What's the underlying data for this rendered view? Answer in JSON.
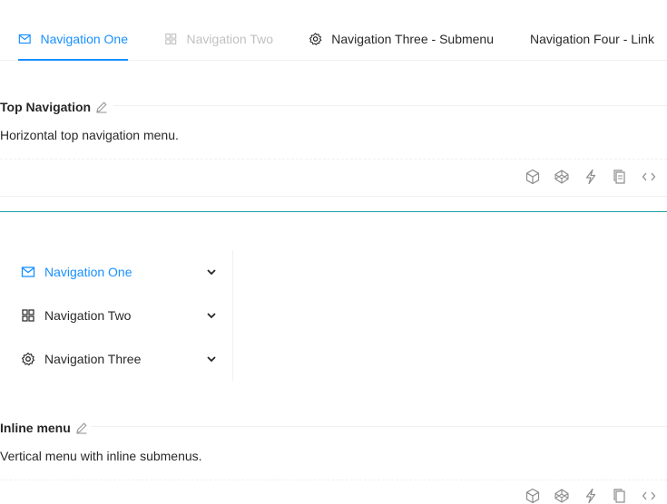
{
  "top_menu": {
    "items": [
      {
        "label": "Navigation One",
        "icon": "mail-icon",
        "state": "active"
      },
      {
        "label": "Navigation Two",
        "icon": "appstore-icon",
        "state": "disabled"
      },
      {
        "label": "Navigation Three - Submenu",
        "icon": "setting-icon",
        "state": "normal"
      },
      {
        "label": "Navigation Four - Link",
        "icon": "",
        "state": "normal"
      }
    ]
  },
  "section_top": {
    "title": "Top Navigation",
    "description": "Horizontal top navigation menu."
  },
  "side_menu": {
    "items": [
      {
        "label": "Navigation One",
        "icon": "mail-icon",
        "state": "active"
      },
      {
        "label": "Navigation Two",
        "icon": "appstore-icon",
        "state": "normal"
      },
      {
        "label": "Navigation Three",
        "icon": "setting-icon",
        "state": "normal"
      }
    ]
  },
  "section_inline": {
    "title": "Inline menu",
    "description": "Vertical menu with inline submenus."
  },
  "actions": [
    "codesandbox-icon",
    "codepen-icon",
    "thunderbolt-icon",
    "copy-icon",
    "code-icon"
  ],
  "colors": {
    "accent": "#1890ff",
    "divider_teal": "#1f9fa6",
    "text": "#262626",
    "disabled": "#bfbfbf"
  }
}
